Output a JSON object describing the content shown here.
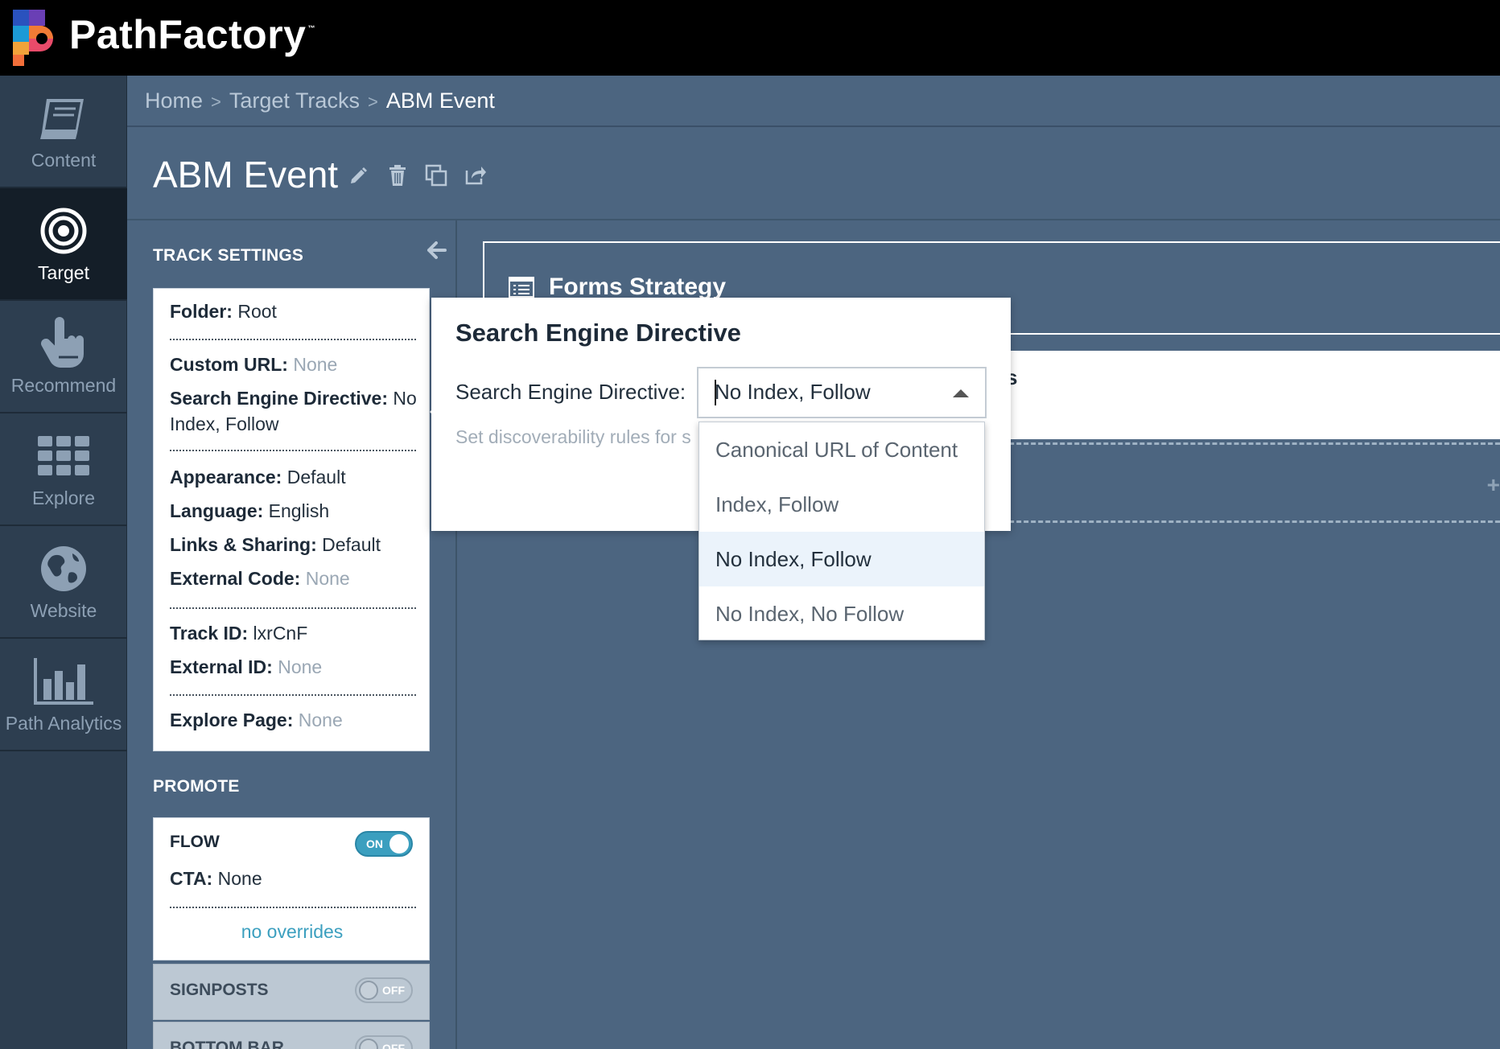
{
  "app": {
    "logo_text": "PathFactory",
    "logo_tm": "™"
  },
  "nav": {
    "items": [
      {
        "label": "Content",
        "icon": "book-icon",
        "active": false
      },
      {
        "label": "Target",
        "icon": "target-icon",
        "active": true
      },
      {
        "label": "Recommend",
        "icon": "hand-pointer-icon",
        "active": false
      },
      {
        "label": "Explore",
        "icon": "grid-icon",
        "active": false
      },
      {
        "label": "Website",
        "icon": "globe-icon",
        "active": false
      },
      {
        "label": "Path Analytics",
        "icon": "bar-chart-icon",
        "active": false
      }
    ]
  },
  "breadcrumb": {
    "items": [
      "Home",
      "Target Tracks",
      "ABM Event"
    ],
    "separator": ">"
  },
  "page": {
    "title": "ABM Event"
  },
  "track_settings": {
    "heading": "TRACK SETTINGS",
    "folder_label": "Folder:",
    "folder_value": "Root",
    "custom_url_label": "Custom URL:",
    "custom_url_value": "None",
    "sed_label": "Search Engine Directive:",
    "sed_value_1": "No",
    "sed_value_2": "Index, Follow",
    "appearance_label": "Appearance:",
    "appearance_value": "Default",
    "language_label": "Language:",
    "language_value": "English",
    "links_label": "Links & Sharing:",
    "links_value": "Default",
    "external_code_label": "External Code:",
    "external_code_value": "None",
    "track_id_label": "Track ID:",
    "track_id_value": "lxrCnF",
    "external_id_label": "External ID:",
    "external_id_value": "None",
    "explore_page_label": "Explore Page:",
    "explore_page_value": "None"
  },
  "promote": {
    "heading": "PROMOTE",
    "flow": {
      "title": "FLOW",
      "toggle": "ON",
      "cta_label": "CTA:",
      "cta_value": "None",
      "overrides_link": "no overrides"
    },
    "signposts": {
      "title": "SIGNPOSTS",
      "toggle": "OFF"
    },
    "bottom_bar": {
      "title": "BOTTOM BAR",
      "toggle": "OFF"
    }
  },
  "main": {
    "forms_strategy_title": "Forms Strategy",
    "strip_text": "s",
    "plus": "+"
  },
  "popover": {
    "title": "Search Engine Directive",
    "field_label": "Search Engine Directive:",
    "help_text": "Set discoverability rules for s",
    "selected_value": "No Index, Follow",
    "options": [
      "Canonical URL of Content",
      "Index, Follow",
      "No Index, Follow",
      "No Index, No Follow"
    ],
    "selected_index": 2
  },
  "colors": {
    "topbar": "#000000",
    "nav_bg": "#2d3e50",
    "content_bg": "#4c6580",
    "accent": "#3b9fbf"
  }
}
